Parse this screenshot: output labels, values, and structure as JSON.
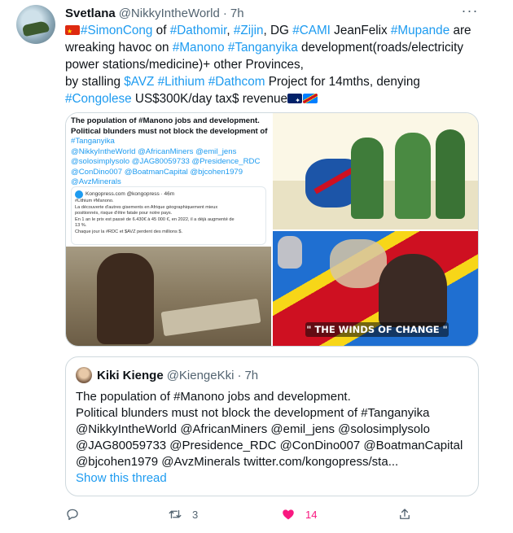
{
  "author": {
    "name": "Svetlana",
    "handle": "@NikkyIntheWorld",
    "separator": "·",
    "time": "7h"
  },
  "more_label": "···",
  "body": {
    "line1": [
      {
        "text": "#SimonCong",
        "link": true
      },
      {
        "text": " of ",
        "link": false
      },
      {
        "text": "#Dathomir",
        "link": true
      },
      {
        "text": ", ",
        "link": false
      },
      {
        "text": "#Zijin",
        "link": true
      },
      {
        "text": ", DG ",
        "link": false
      },
      {
        "text": "#CAMI",
        "link": true
      },
      {
        "text": " JeanFelix ",
        "link": false
      },
      {
        "text": "#Mupande",
        "link": true
      },
      {
        "text": " are",
        "link": false
      }
    ],
    "line2": [
      {
        "text": "wreaking havoc on ",
        "link": false
      },
      {
        "text": "#Manono",
        "link": true
      },
      {
        "text": " ",
        "link": false
      },
      {
        "text": "#Tanganyika",
        "link": true
      },
      {
        "text": " development(roads/electricity",
        "link": false
      }
    ],
    "line3": "power stations/medicine)+ other Provinces,",
    "line4": [
      {
        "text": "by stalling ",
        "link": false
      },
      {
        "text": "$AVZ",
        "link": true
      },
      {
        "text": " ",
        "link": false
      },
      {
        "text": "#Lithium",
        "link": true
      },
      {
        "text": " ",
        "link": false
      },
      {
        "text": "#Dathcom",
        "link": true
      },
      {
        "text": " Project for 14mths, denying",
        "link": false
      }
    ],
    "line5": [
      {
        "text": "#Congolese",
        "link": true
      },
      {
        "text": " US$300K/day tax$ revenue",
        "link": false
      }
    ]
  },
  "media": {
    "panel1": {
      "lines": [
        "The population of #Manono jobs and development.",
        "Political blunders must not block the development of",
        "#Tanganyika",
        "@NikkyIntheWorld @AfricanMiners @emil_jens",
        "@solosimplysolo @JAG80059733 @Presidence_RDC",
        "@ConDino007 @BoatmanCapital @bjcohen1979",
        "@AvzMinerals"
      ],
      "card_source": "Kongopress.com @kongopress · 46m",
      "card_lines": [
        "#Lithium #Manono.",
        "La découverte d'autres gisements en Afrique géographiquement mieux",
        "positionnés, risque d'être fatale pour notre pays.",
        "En 1 an le prix est passé de 6.430€ à 45 000 €, en 2022, il a déjà augmenté de",
        "13 %.",
        "Chaque jour la #RDC et $AVZ perdent des millions $."
      ]
    },
    "panel3_banner": "\" THE WINDS OF CHANGE \""
  },
  "quote": {
    "name": "Kiki Kienge",
    "handle": "@KiengeKki",
    "separator": "·",
    "time": "7h",
    "lines": [
      "The population of #Manono jobs and development.",
      "Political blunders must not block the development of #Tanganyika",
      "@NikkyIntheWorld @AfricanMiners @emil_jens @solosimplysolo",
      "@JAG80059733 @Presidence_RDC @ConDino007  @BoatmanCapital",
      "@bjcohen1979 @AvzMinerals twitter.com/kongopress/sta..."
    ],
    "show_thread": "Show this thread"
  },
  "actions": {
    "reply_count": "",
    "retweet_count": "3",
    "like_count": "14",
    "share_count": ""
  },
  "colors": {
    "link": "#1d9bf0",
    "secondary": "#536471",
    "like": "#f91880",
    "border": "#cfd9de"
  }
}
